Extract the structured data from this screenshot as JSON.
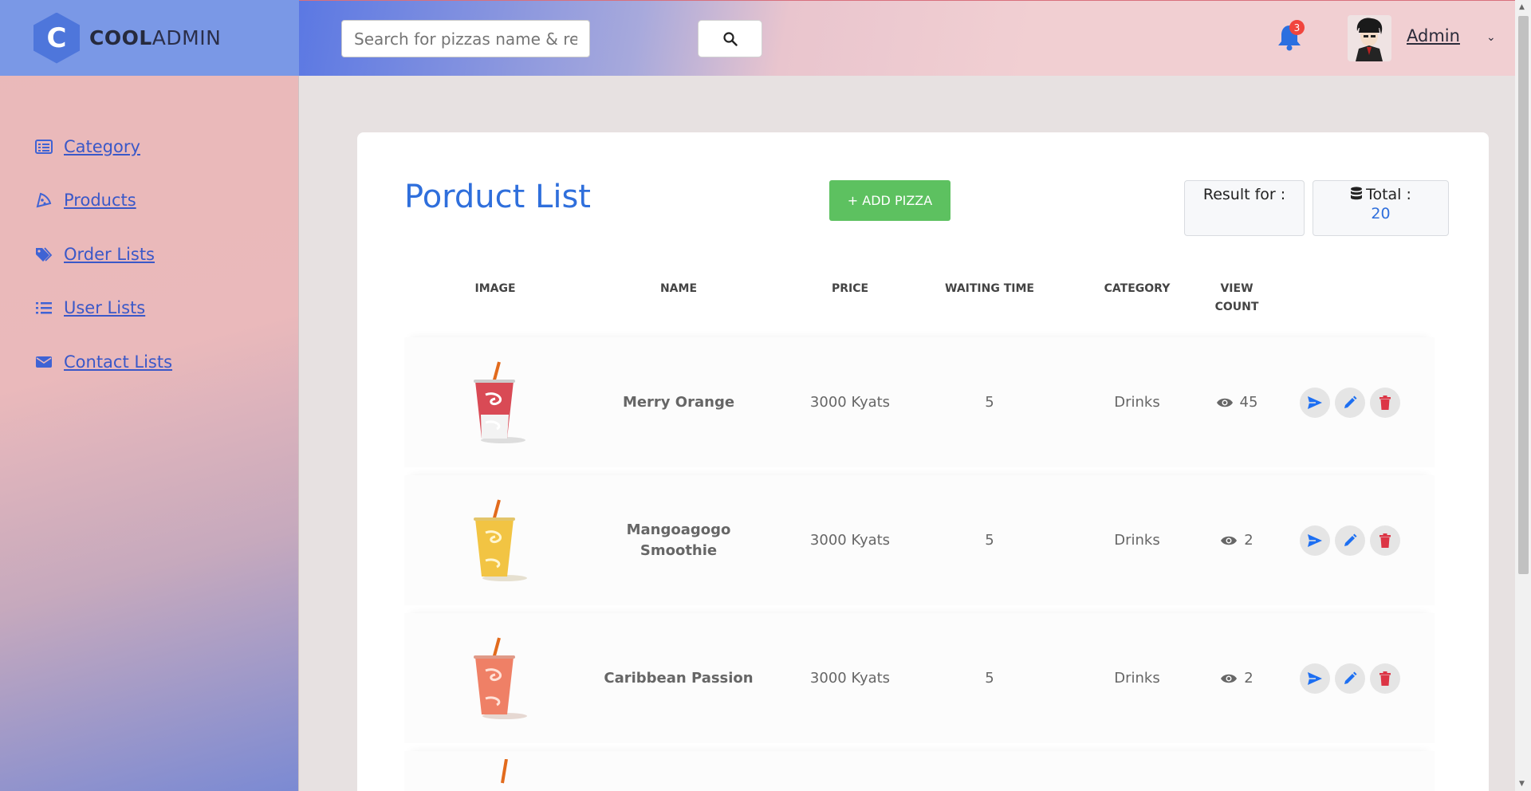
{
  "brand": {
    "bold": "COOL",
    "light": "ADMIN",
    "logo_letter": "C"
  },
  "sidebar": {
    "items": [
      {
        "label": " Category",
        "icon": "list-icon"
      },
      {
        "label": " Products",
        "icon": "pizza-icon"
      },
      {
        "label": " Order Lists",
        "icon": "tags-icon"
      },
      {
        "label": " User Lists",
        "icon": "list-ul-icon"
      },
      {
        "label": " Contact Lists",
        "icon": "envelope-icon"
      }
    ]
  },
  "header": {
    "search_placeholder": "Search for pizzas name & reports...",
    "notification_count": "3",
    "user_name": "Admin"
  },
  "main": {
    "title": "Porduct List",
    "add_button": "+ ADD PIZZA",
    "result_label": "Result for :",
    "total_label": "Total :",
    "total_value": "20",
    "columns": [
      "IMAGE",
      "NAME",
      "PRICE",
      "WAITING TIME",
      "CATEGORY",
      "VIEW COUNT"
    ],
    "rows": [
      {
        "name": "Merry Orange",
        "price": "3000 Kyats",
        "waiting": "5",
        "category": "Drinks",
        "views": "45",
        "cup_color": "#d94a55"
      },
      {
        "name": "Mangoagogo Smoothie",
        "price": "3000 Kyats",
        "waiting": "5",
        "category": "Drinks",
        "views": "2",
        "cup_color": "#f2c443"
      },
      {
        "name": "Caribbean Passion",
        "price": "3000 Kyats",
        "waiting": "5",
        "category": "Drinks",
        "views": "2",
        "cup_color": "#ef8066"
      }
    ]
  },
  "colors": {
    "accent": "#2f6fdc",
    "success": "#5dc160",
    "danger": "#dc3545"
  }
}
